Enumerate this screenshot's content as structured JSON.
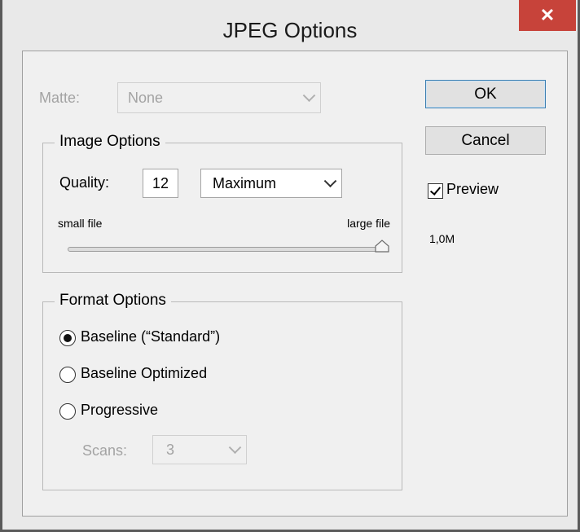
{
  "window": {
    "title": "JPEG Options",
    "close_glyph": "✕"
  },
  "matte": {
    "label": "Matte:",
    "value": "None"
  },
  "image_options": {
    "legend": "Image Options",
    "quality_label": "Quality:",
    "quality_value": "12",
    "quality_preset": "Maximum",
    "slider_min_label": "small file",
    "slider_max_label": "large file",
    "slider_value": 12,
    "slider_min": 0,
    "slider_max": 12
  },
  "format_options": {
    "legend": "Format Options",
    "options": [
      {
        "label": "Baseline (“Standard”)",
        "selected": true
      },
      {
        "label": "Baseline Optimized",
        "selected": false
      },
      {
        "label": "Progressive",
        "selected": false
      }
    ],
    "scans_label": "Scans:",
    "scans_value": "3"
  },
  "buttons": {
    "ok": "OK",
    "cancel": "Cancel"
  },
  "preview": {
    "label": "Preview",
    "checked": true,
    "size": "1,0M"
  }
}
